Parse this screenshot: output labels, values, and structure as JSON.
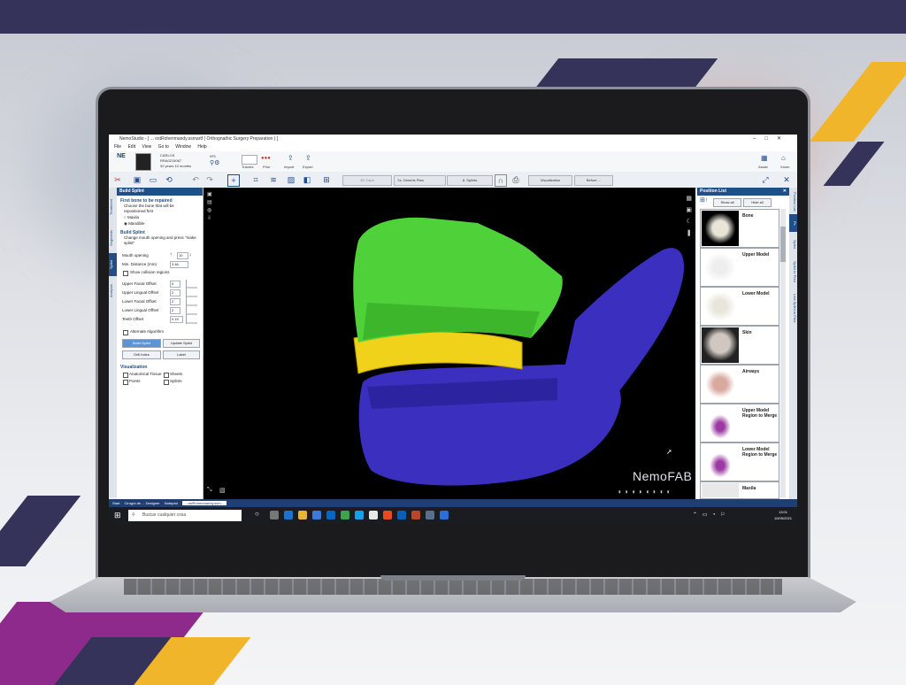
{
  "window": {
    "title": "NemoStudio - [ ... ostRohenmandy.ssmartf ( Orthognathic Surgery Preparation ) ]",
    "controls": [
      "–",
      "□",
      "✕"
    ]
  },
  "menu": [
    "File",
    "Edit",
    "View",
    "Go to",
    "Window",
    "Help"
  ],
  "ribbon": {
    "logo": "NE",
    "patient_name": "CARLOS",
    "patient_id": "RRA0215067",
    "patient_age": "32 years 10 months",
    "case_no": "Nº3",
    "labels": [
      "Tracers",
      "Prior",
      "Import",
      "Export"
    ],
    "right_labels": [
      "Assist",
      "Xoom"
    ]
  },
  "toolbar": {
    "buttons": [
      "3D Ceph",
      "7a. Generic Plan",
      "8. Splints",
      "Visualization",
      "Before ..."
    ]
  },
  "left_tabs": [
    "Treatment",
    "Segments",
    "Splint",
    "Analysis"
  ],
  "build_splint": {
    "panel_title": "Build Splint",
    "first_bone_title": "First bone to be repaired",
    "choose_text": "Choose the bone that will be repositioned first",
    "radio_maxila": "Maxila",
    "radio_mandible": "Mandible",
    "section_title": "Build Splint",
    "desc": "Change mouth opening and press \"make splint\"",
    "mouth_opening_label": "Mouth opening",
    "mouth_opening_value": "10",
    "min_distance_label": "Min. Distance (mm)",
    "min_distance_value": "3.46",
    "show_collision": "Show collision regions",
    "offsets": [
      {
        "label": "Upper Facial Offset",
        "value": "0"
      },
      {
        "label": "Upper Lingual Offset",
        "value": "2"
      },
      {
        "label": "Lower Facial Offset",
        "value": "2"
      },
      {
        "label": "Lower Lingual Offset",
        "value": "2"
      },
      {
        "label": "Teeth Offset",
        "value": "0.15"
      }
    ],
    "alternate_algorithm": "Alternate Algorithm",
    "btn_build": "Build Splint",
    "btn_update": "Update Splint",
    "btn_drill": "Drill holes",
    "btn_label": "Label",
    "visualization_title": "Visualization",
    "vis_opts": [
      "Anatomical Tissue",
      "Sheets",
      "Points",
      "Splints"
    ]
  },
  "viewport": {
    "brand": "NemoFAB",
    "colors": {
      "maxilla": "#4fd13a",
      "mandible": "#3b2fbf",
      "splint": "#f0d21a",
      "background": "#000000"
    }
  },
  "position_list": {
    "title": "Position List",
    "btn_show_all": "Show all",
    "btn_hide_all": "Hide all",
    "items": [
      {
        "label": "Bone"
      },
      {
        "label": "Upper Model"
      },
      {
        "label": "Lower Model"
      },
      {
        "label": "Skin"
      },
      {
        "label": "Airways"
      },
      {
        "label": "Upper Model Region to Merge"
      },
      {
        "label": "Lower Model Region to Merge"
      },
      {
        "label": "Maxila"
      }
    ]
  },
  "right_tabs": [
    "Position List",
    "Pc",
    "Splint",
    "Splint to Print",
    "Last Splint to Print"
  ],
  "statusbar": [
    "Start",
    "Cirugía de ... Designer",
    "Notepad",
    "...ostRohenmandy.ssm..."
  ],
  "taskbar": {
    "search_placeholder": "Buscar cualquier cosa",
    "time": "13:01",
    "date": "10/05/2021"
  }
}
